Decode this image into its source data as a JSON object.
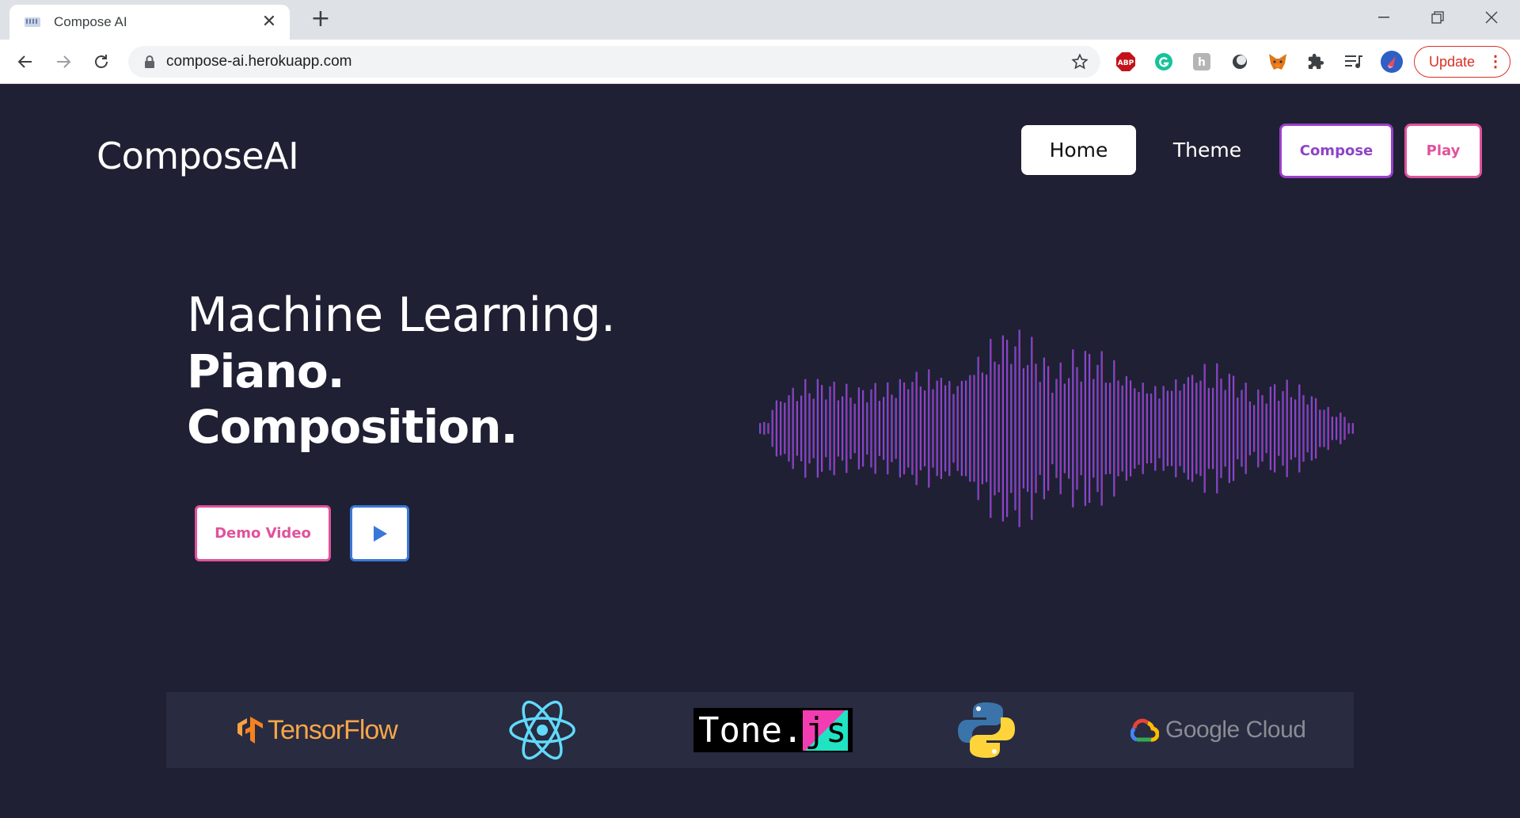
{
  "browser": {
    "tab_title": "Compose AI",
    "url": "compose-ai.herokuapp.com",
    "update_label": "Update"
  },
  "page": {
    "brand": "ComposeAI",
    "nav": {
      "home": "Home",
      "theme": "Theme",
      "compose": "Compose",
      "play": "Play"
    },
    "hero": {
      "line1": "Machine Learning.",
      "line2": "Piano.",
      "line3": "Composition."
    },
    "demo_button": "Demo Video",
    "logos": {
      "tensorflow": "TensorFlow",
      "tone_main": "Tone.",
      "tone_js": "js",
      "google_cloud": "Google Cloud"
    },
    "colors": {
      "background": "#1f2033",
      "accent_pink": "#e0529c",
      "accent_purple": "#9b3fc9",
      "accent_blue": "#3a78d8"
    }
  }
}
